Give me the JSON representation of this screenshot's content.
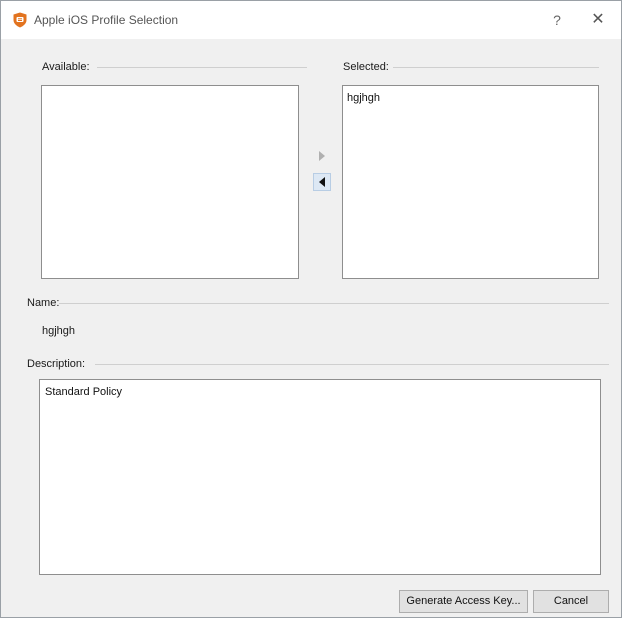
{
  "window": {
    "title": "Apple iOS Profile Selection",
    "help_label": "?",
    "close_label": "✕"
  },
  "available": {
    "label": "Available:",
    "items": []
  },
  "selected": {
    "label": "Selected:",
    "items": [
      "hgjhgh"
    ]
  },
  "name": {
    "label": "Name:",
    "value": "hgjhgh"
  },
  "description": {
    "label": "Description:",
    "value": "Standard Policy"
  },
  "buttons": {
    "generate": "Generate Access Key...",
    "cancel": "Cancel"
  },
  "colors": {
    "app_icon": "#e2731f",
    "arrow_active_bg": "#dde8f4"
  },
  "icons": {
    "app": "shield-app-icon",
    "move_right": "triangle-right-icon",
    "move_left": "triangle-left-icon"
  }
}
